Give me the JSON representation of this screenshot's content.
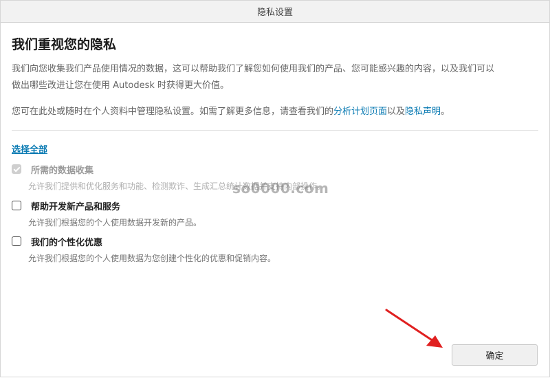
{
  "window": {
    "title": "隐私设置"
  },
  "main": {
    "heading": "我们重视您的隐私",
    "para1_line1": "我们向您收集我们产品使用情况的数据，这可以帮助我们了解您如何使用我们的产品、您可能感兴趣的内容，以及我们可以",
    "para1_line2": "做出哪些改进让您在使用 Autodesk 时获得更大价值。",
    "para2_prefix": "您可在此处或随时在个人资料中管理隐私设置。如需了解更多信息，请查看我们的",
    "para2_link1": "分析计划页面",
    "para2_mid": "以及",
    "para2_link2": "隐私声明",
    "para2_suffix": "。",
    "select_all": "选择全部"
  },
  "options": [
    {
      "label": "所需的数据收集",
      "desc": "允许我们提供和优化服务和功能、检测欺诈、生成汇总统计数据并支持内部操作。",
      "checked": true,
      "disabled": true
    },
    {
      "label": "帮助开发新产品和服务",
      "desc": "允许我们根据您的个人使用数据开发新的产品。",
      "checked": false,
      "disabled": false
    },
    {
      "label": "我们的个性化优惠",
      "desc": "允许我们根据您的个人使用数据为您创建个性化的优惠和促销内容。",
      "checked": false,
      "disabled": false
    }
  ],
  "watermark": "so0000.com",
  "footer": {
    "ok_label": "确定"
  },
  "colors": {
    "link": "#0b7bb3",
    "arrow": "#e02020",
    "titlebar": "#f2f2f2"
  },
  "icons": {
    "arrow": "red-pointer-arrow-icon",
    "checkmark": "checkmark-icon"
  }
}
